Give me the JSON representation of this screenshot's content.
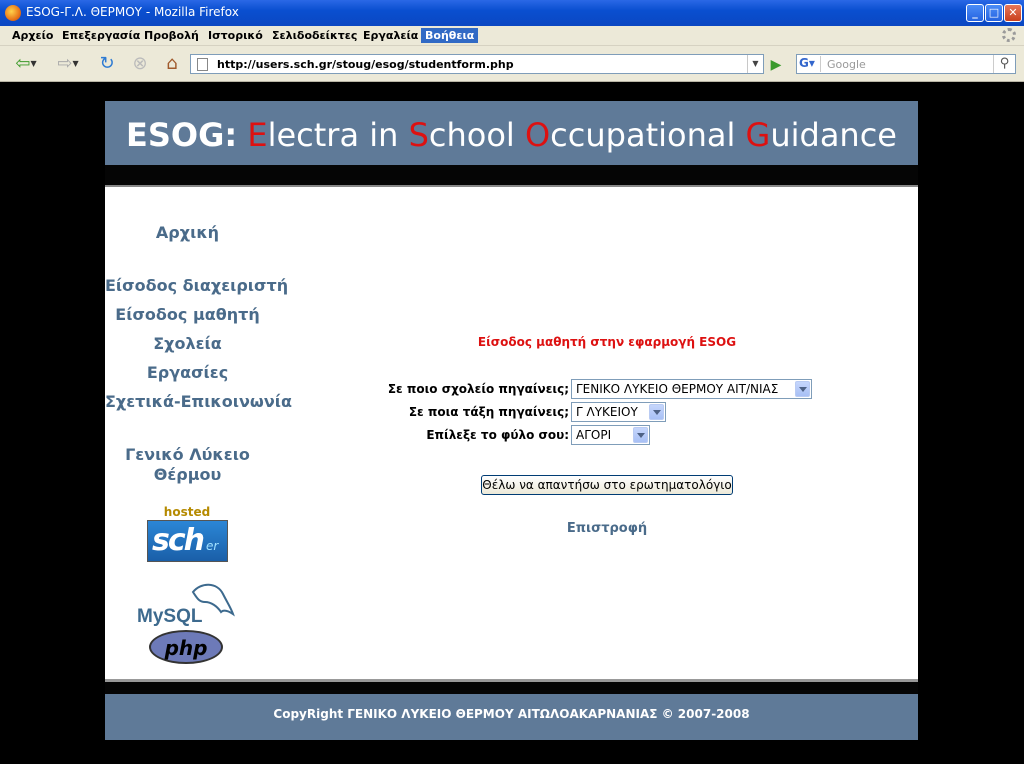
{
  "window": {
    "title": "ESOG-Γ.Λ. ΘΕΡΜΟΥ - Mozilla Firefox",
    "minimize": "_",
    "maximize": "□",
    "close": "✕"
  },
  "menubar": {
    "items": [
      "Αρχείο",
      "Επεξεργασία",
      "Προβολή",
      "Ιστορικό",
      "Σελιδοδείκτες",
      "Εργαλεία",
      "Βοήθεια"
    ],
    "active": "Βοήθεια"
  },
  "navbar": {
    "url": "http://users.sch.gr/stoug/esog/studentform.php",
    "search_placeholder": "Google",
    "icons": [
      "back-arrow-icon",
      "forward-arrow-icon",
      "reload-icon",
      "stop-icon",
      "home-icon",
      "page-icon",
      "go-arrow-icon",
      "google-icon",
      "magnifier-icon"
    ]
  },
  "banner": {
    "prefix": "ESOG:",
    "words": [
      {
        "initial": "E",
        "rest": "lectra"
      },
      {
        "initial": "",
        "rest": "in"
      },
      {
        "initial": "S",
        "rest": "chool"
      },
      {
        "initial": "O",
        "rest": "ccupational"
      },
      {
        "initial": "G",
        "rest": "uidance"
      }
    ],
    "accent_color": "#dd1111",
    "bg_color": "#5f7a98"
  },
  "sidebar": {
    "links": [
      "Αρχική",
      "Είσοδος διαχειριστή",
      "Είσοδος μαθητή",
      "Σχολεία",
      "Εργασίες",
      "Σχετικά-Επικοινωνία"
    ],
    "school_line1": "Γενικό Λύκειο",
    "school_line2": "Θέρμου",
    "hosted_by": "hosted by",
    "sch_logo_text": "sch",
    "sch_logo_suffix": "er",
    "mysql_logo_text": "MySQL",
    "php_logo_text": "php"
  },
  "form": {
    "title": "Είσοδος μαθητή στην εφαρμογή ESOG",
    "school_label": "Σε ποιο σχολείο πηγαίνεις;",
    "school_value": "ΓΕΝΙΚΟ ΛΥΚΕΙΟ ΘΕΡΜΟΥ ΑΙΤ/ΝΙΑΣ",
    "class_label": "Σε ποια τάξη πηγαίνεις;",
    "class_value": "Γ ΛΥΚΕΙΟΥ",
    "gender_label": "Επίλεξε το φύλο σου:",
    "gender_value": "ΑΓΟΡΙ",
    "submit_label": "Θέλω να απαντήσω στο ερωτηματολόγιο",
    "back_label": "Επιστροφή"
  },
  "footer": {
    "copyright": "CopyRight ΓΕΝΙΚΟ ΛΥΚΕΙΟ ΘΕΡΜΟΥ ΑΙΤΩΛΟΑΚΑΡΝΑΝΙΑΣ © 2007-2008"
  }
}
